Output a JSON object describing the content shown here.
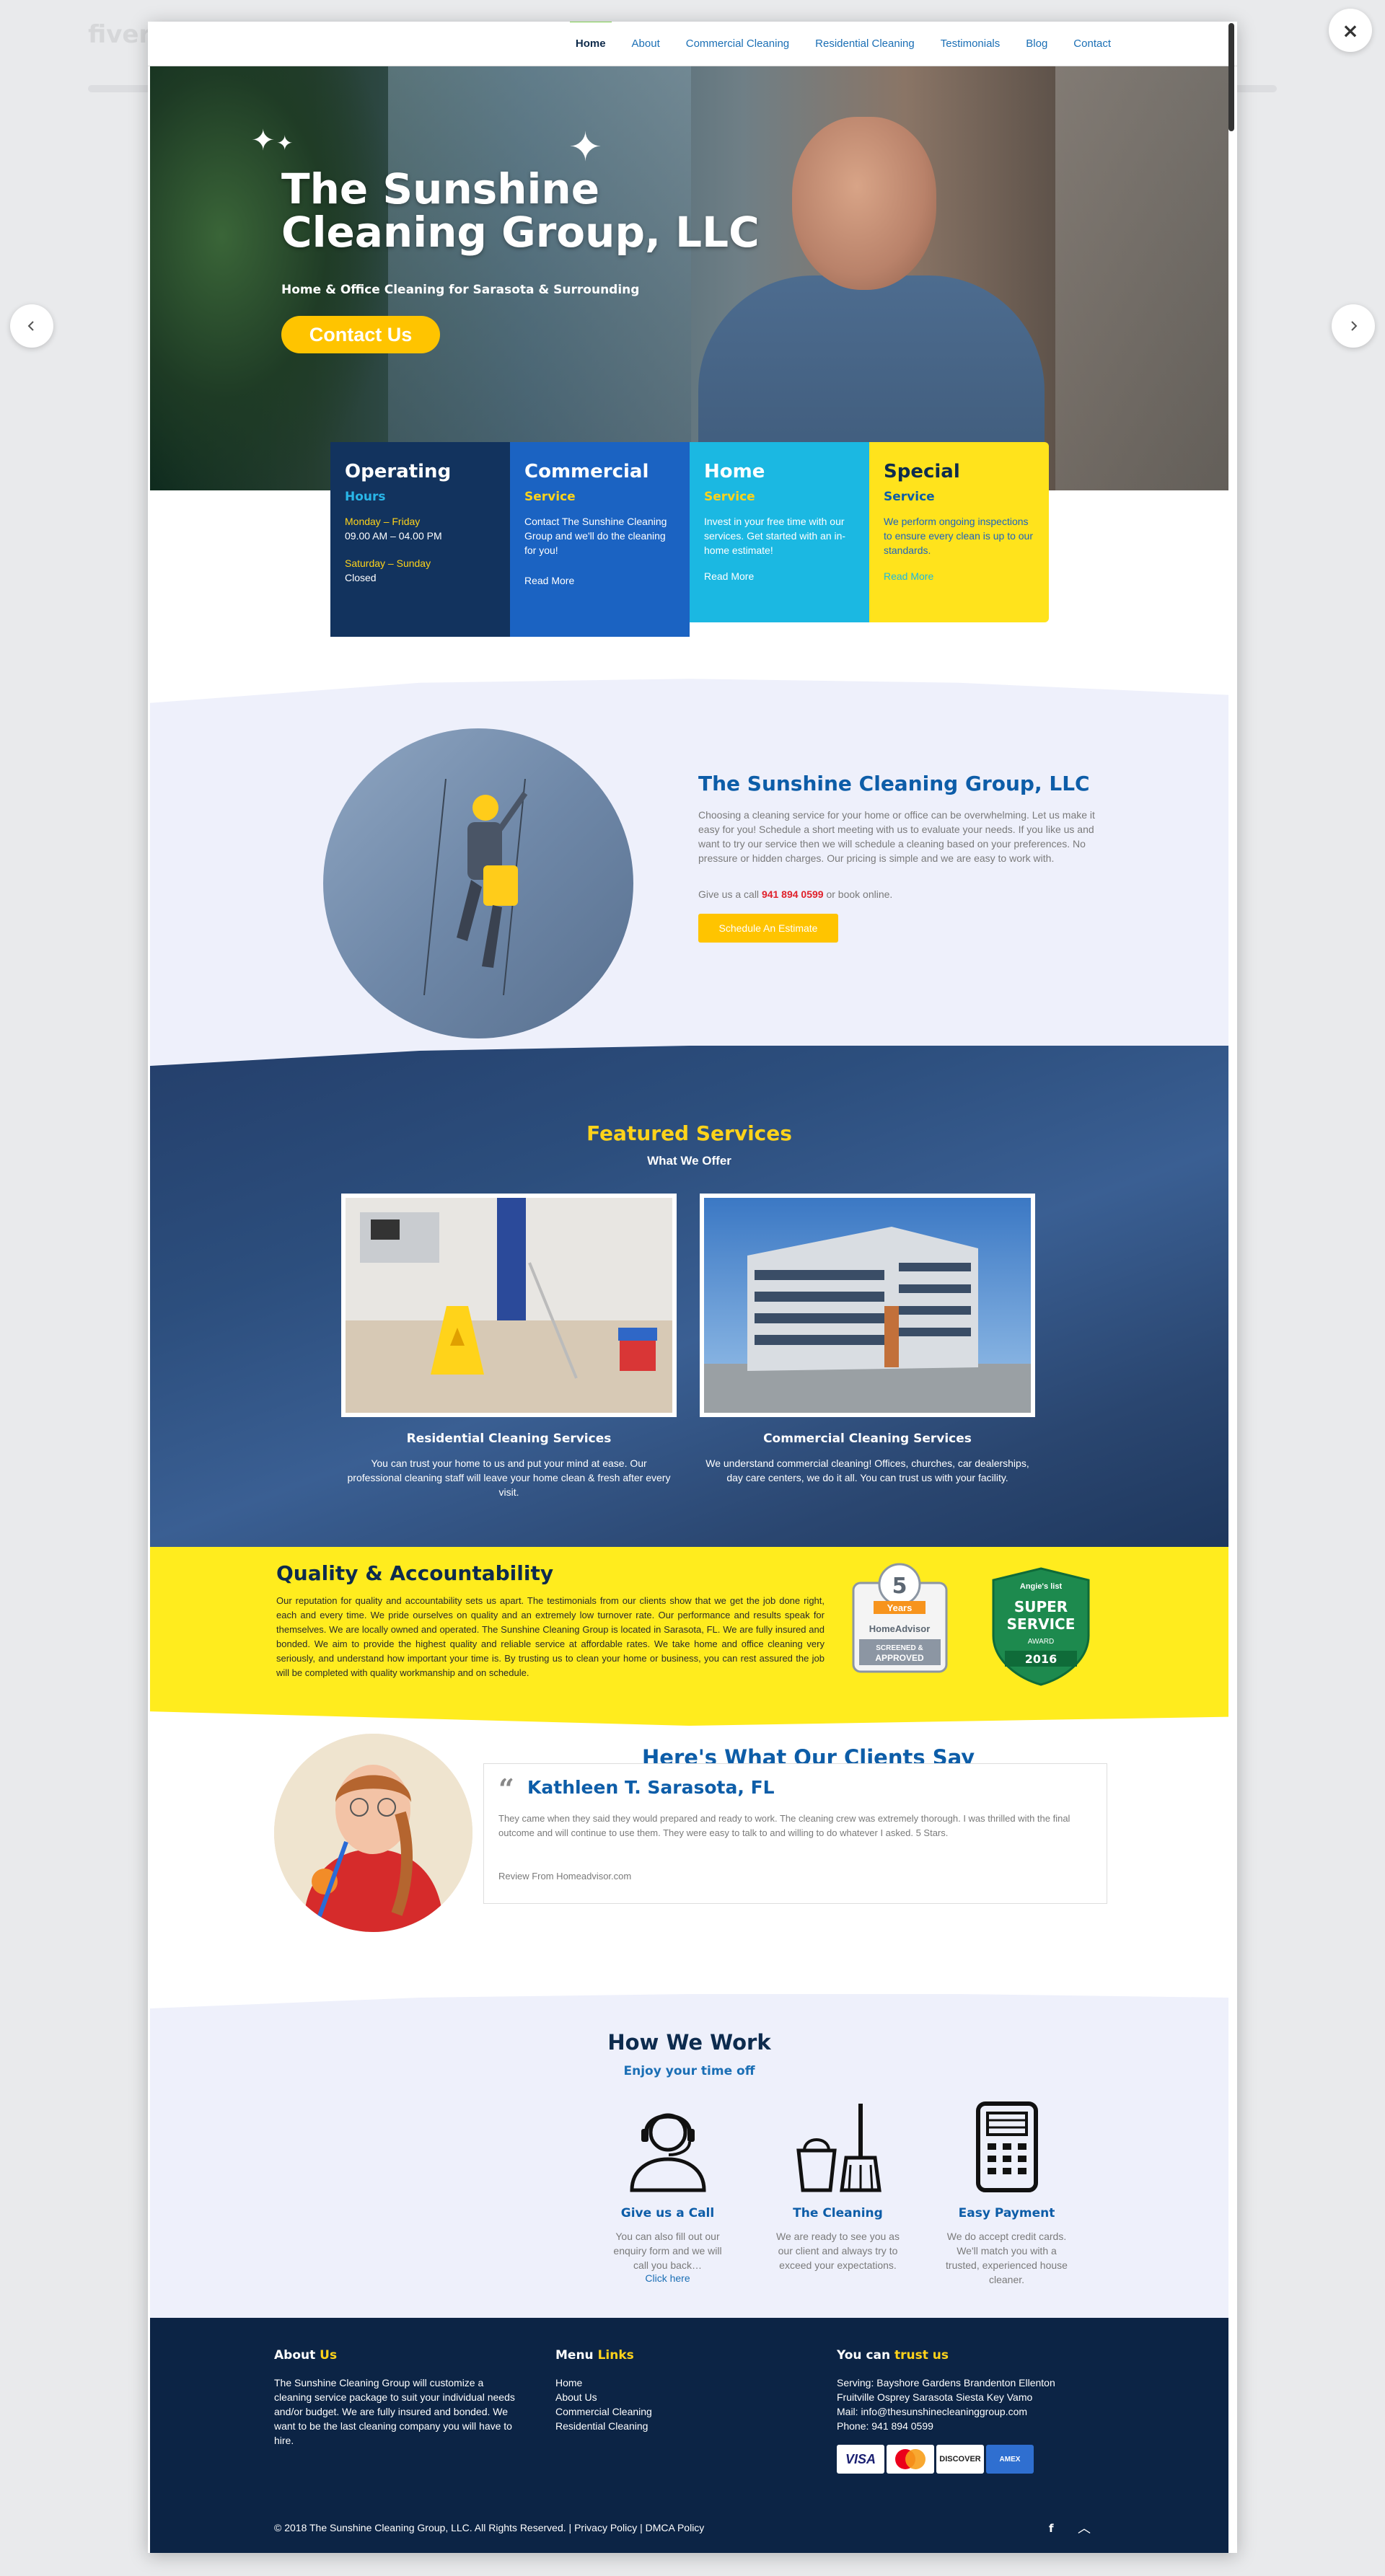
{
  "lightbox": {
    "backdrop_logo": "fiverr",
    "close_label": "×",
    "prev_label": "‹",
    "next_label": "›"
  },
  "nav": {
    "items": [
      "Home",
      "About",
      "Commercial Cleaning",
      "Residential Cleaning",
      "Testimonials",
      "Blog",
      "Contact"
    ],
    "active": "Home"
  },
  "hero": {
    "title": "The Sunshine Cleaning Group, LLC",
    "subtitle": "Home & Office Cleaning for Sarasota & Surrounding",
    "cta": "Contact Us"
  },
  "boxes": {
    "hours": {
      "title": "Operating",
      "subtitle": "Hours",
      "weekday_label": "Monday – Friday",
      "weekday_hours": "09.00 AM – 04.00 PM",
      "weekend_label": "Saturday – Sunday",
      "weekend_hours": "Closed"
    },
    "commercial": {
      "title": "Commercial",
      "subtitle": "Service",
      "text": "Contact The Sunshine Cleaning Group and we'll do the cleaning for you!",
      "link": "Read More"
    },
    "home": {
      "title": "Home",
      "subtitle": "Service",
      "text": "Invest in your free time with our services. Get started with an in-home estimate!",
      "link": "Read More"
    },
    "special": {
      "title": "Special",
      "subtitle": "Service",
      "text": "We perform ongoing inspections to ensure every clean is up to our standards.",
      "link": "Read More"
    }
  },
  "about": {
    "title": "The Sunshine Cleaning Group, LLC",
    "text": "Choosing a cleaning service for your home or office can be overwhelming. Let us make it easy for you! Schedule a short meeting with us to evaluate your needs. If you like us and want to try our service then we will schedule a cleaning based on your preferences. No pressure or hidden charges. Our pricing is simple and we are easy to work with.",
    "call_prefix": "Give us a call",
    "phone": "941 894 0599",
    "call_suffix": "or book online.",
    "button": "Schedule An Estimate"
  },
  "featured": {
    "title": "Featured Services",
    "subtitle": "What We Offer",
    "services": [
      {
        "title": "Residential Cleaning Services",
        "text": "You can trust your home to us and put your mind at ease. Our professional cleaning staff will leave your home clean & fresh after every visit."
      },
      {
        "title": "Commercial Cleaning Services",
        "text": "We understand commercial cleaning! Offices, churches, car dealerships, day care centers, we do it all. You can trust us with your facility."
      }
    ]
  },
  "quality": {
    "title": "Quality & Accountability",
    "text": "Our reputation for quality and accountability sets us apart. The testimonials from our clients show that we get the job done right, each and every time. We pride ourselves on quality and an extremely low turnover rate. Our performance and results speak for themselves. We are locally owned and operated. The Sunshine Cleaning Group is located in Sarasota, FL. We are fully insured and bonded. We aim to provide the highest quality and reliable service at affordable rates. We take home and office cleaning very seriously, and understand how important your time is. By trusting us to clean your home or business, you can rest assured the job will be completed with quality workmanship and on schedule.",
    "badge1": {
      "number": "5",
      "years": "Years",
      "brand": "HomeAdvisor",
      "line1": "SCREENED &",
      "line2": "APPROVED"
    },
    "badge2": {
      "brand": "Angie's list",
      "line1": "SUPER",
      "line2": "SERVICE",
      "line3": "AWARD",
      "year": "2016"
    }
  },
  "testimonials": {
    "title": "Here's What Our Clients Say",
    "name": "Kathleen T. Sarasota, FL",
    "text": "They came when they said they would prepared and ready to work. The cleaning crew was extremely thorough. I was thrilled with the final outcome and will continue to use them. They were easy to talk to and willing to do whatever I asked. 5 Stars.",
    "source": "Review From Homeadvisor.com"
  },
  "how": {
    "title": "How We Work",
    "subtitle": "Enjoy your time off",
    "steps": [
      {
        "title": "Give us a Call",
        "text": "You can also fill out our enquiry form and we will call you back…",
        "link": "Click here"
      },
      {
        "title": "The Cleaning",
        "text": "We are ready to see you as our client and always try to exceed your expectations."
      },
      {
        "title": "Easy Payment",
        "text": "We do accept credit cards. We'll match you with a trusted, experienced house cleaner."
      }
    ]
  },
  "footer": {
    "about_title_a": "About",
    "about_title_b": "Us",
    "about_text": "The Sunshine Cleaning Group will customize a cleaning service package to suit your individual needs and/or budget. We are fully insured and bonded. We want to be the last cleaning company you will have to hire.",
    "menu_title_a": "Menu",
    "menu_title_b": "Links",
    "menu": [
      "Home",
      "About Us",
      "Commercial Cleaning",
      "Residential Cleaning"
    ],
    "trust_title_a": "You can",
    "trust_title_b": "trust us",
    "serving": "Serving: Bayshore Gardens Brandenton Ellenton Fruitville Osprey Sarasota Siesta Key Vamo",
    "mail": "Mail: info@thesunshinecleaninggroup.com",
    "phone": "Phone: 941 894 0599",
    "cards": [
      "VISA",
      "MasterCard",
      "DISCOVER",
      "AMERICAN EXPRESS"
    ],
    "copyright": "© 2018 The Sunshine Cleaning Group, LLC. All Rights Reserved.",
    "privacy": "Privacy Policy",
    "dmca": "DMCA Policy",
    "separator": "|",
    "fb": "f",
    "up": "︿"
  },
  "colors": {
    "navy": "#12335e",
    "blue": "#1b63c2",
    "cyan": "#1bb8e2",
    "yellow": "#ffe31c",
    "gold": "#ffc400",
    "red": "#e0202a"
  }
}
